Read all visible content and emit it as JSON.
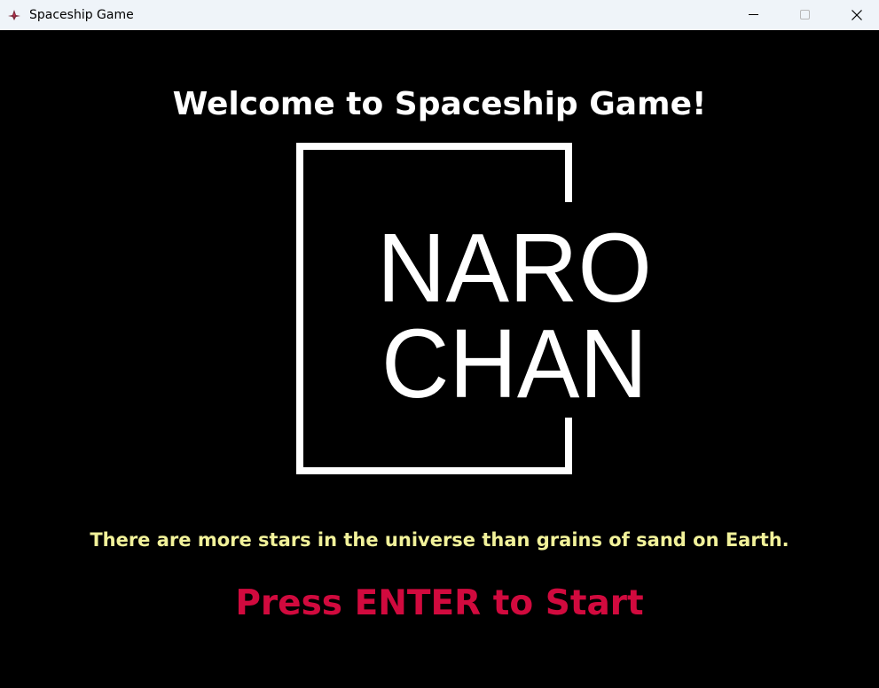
{
  "window": {
    "title": "Spaceship Game",
    "app_icon": "spaceship-icon",
    "controls": [
      "minimize-icon",
      "maximize-icon",
      "close-icon"
    ]
  },
  "game": {
    "welcome_text": "Welcome to Spaceship Game!",
    "logo": {
      "line1": "NARO",
      "line2": "CHAN"
    },
    "fact_text": "There are more stars in the universe than grains of sand on Earth.",
    "prompt_text": "Press ENTER to Start"
  },
  "colors": {
    "background": "#000000",
    "titlebar": "#eff4f9",
    "welcome": "#ffffff",
    "fact": "#f2f29a",
    "prompt": "#d10a3e"
  }
}
